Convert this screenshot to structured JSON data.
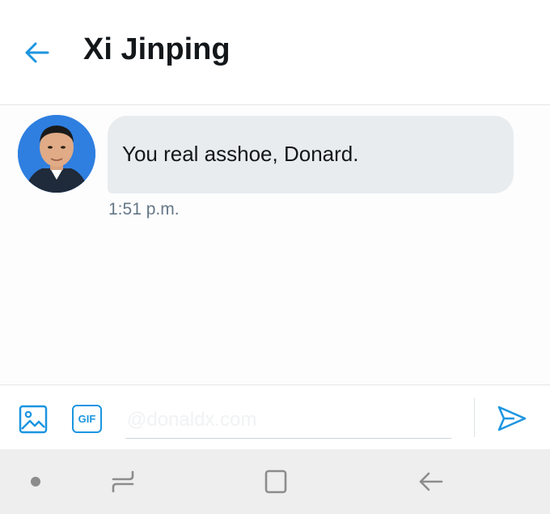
{
  "header": {
    "title": "Xi Jinping",
    "back_icon": "arrow-left-icon"
  },
  "conversation": {
    "messages": [
      {
        "sender": "Xi Jinping",
        "text": "You real asshoe, Donard.",
        "time": "1:51 p.m."
      }
    ]
  },
  "composer": {
    "placeholder": "@donaldx.com",
    "gif_label": "GIF",
    "media_icon": "image-icon",
    "send_icon": "send-icon"
  },
  "system_nav": {
    "dot_icon": "dot-icon",
    "recents_icon": "recents-icon",
    "home_icon": "home-square-icon",
    "back_icon": "back-arrow-icon"
  },
  "colors": {
    "accent": "#1b95e0",
    "bubble": "#e8ecef",
    "text": "#14171a",
    "muted": "#657786",
    "navbar": "#eeeeee"
  }
}
